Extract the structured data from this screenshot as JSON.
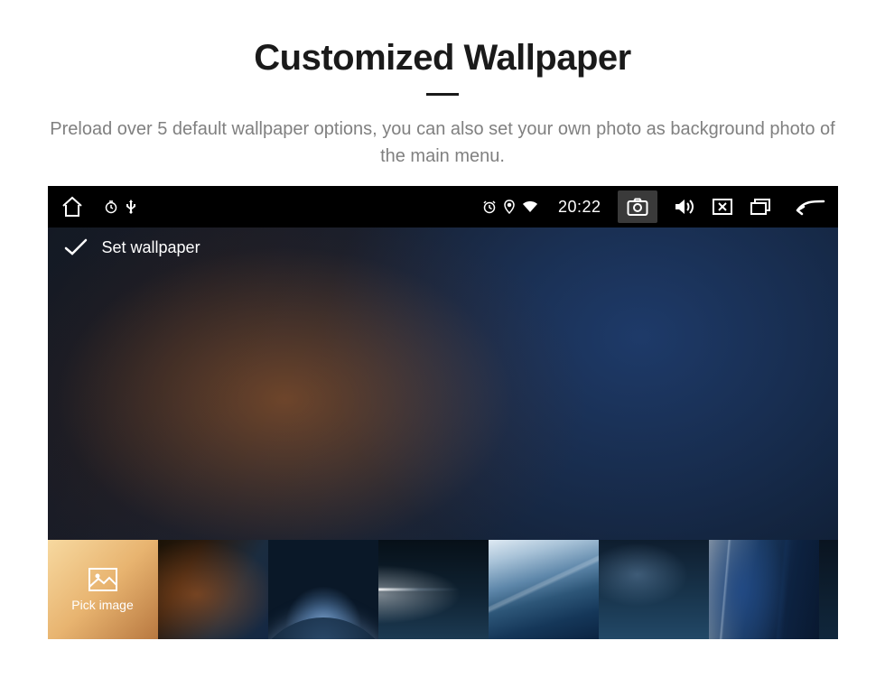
{
  "page": {
    "heading": "Customized Wallpaper",
    "subheading": "Preload over 5 default wallpaper options, you can also set your own photo as background photo of the main menu."
  },
  "statusbar": {
    "time": "20:22"
  },
  "screen": {
    "title": "Set wallpaper"
  },
  "thumbs": {
    "pick_image_label": "Pick image"
  }
}
